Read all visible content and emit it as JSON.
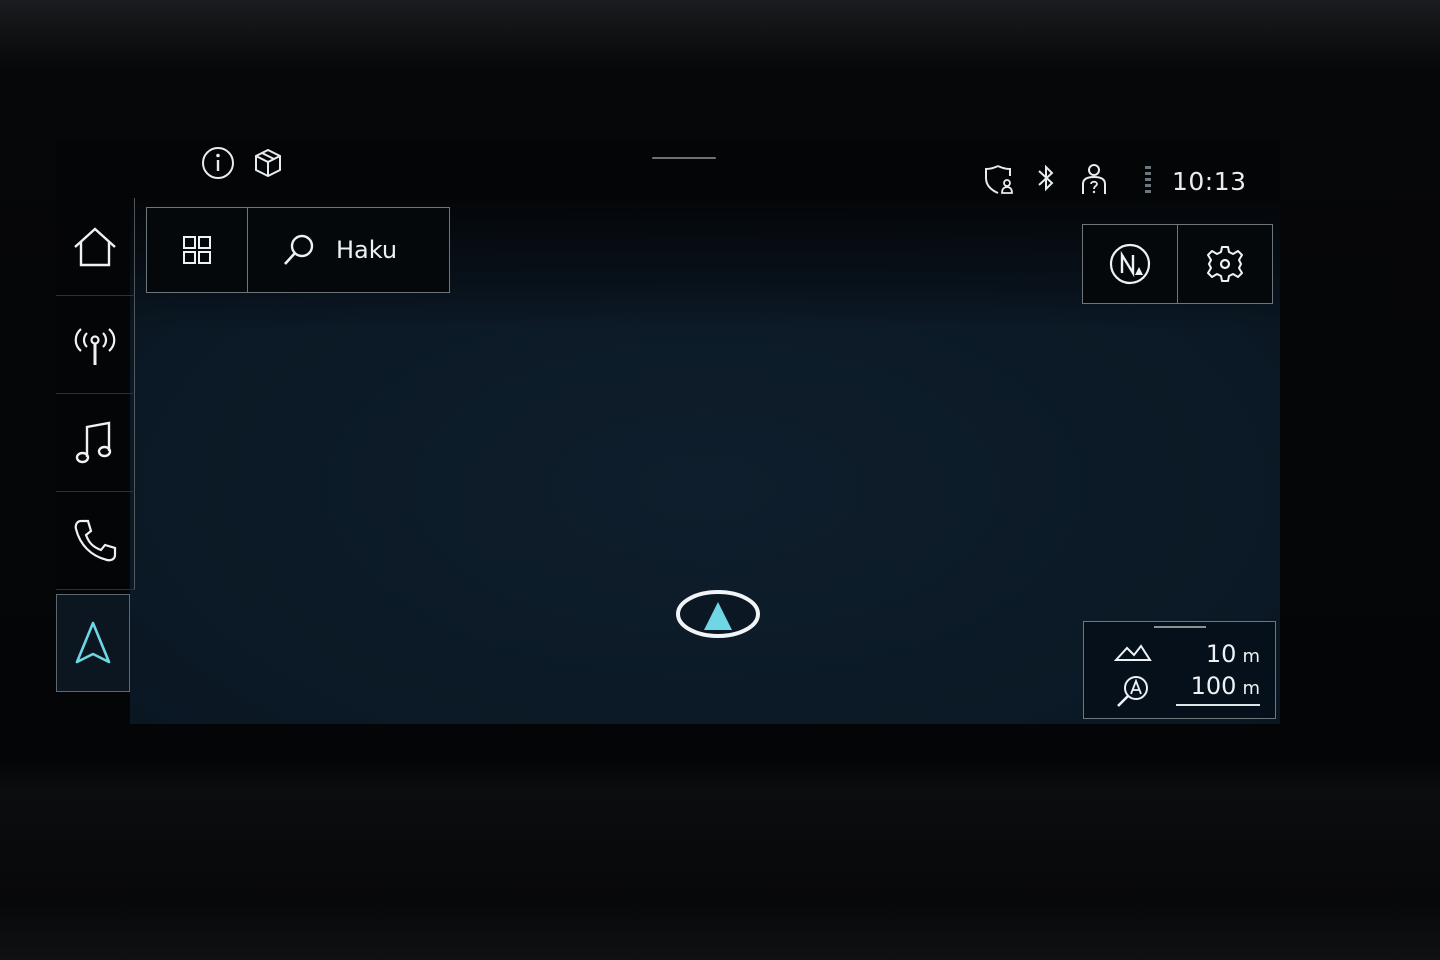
{
  "statusbar": {
    "info_icon": "info-icon",
    "package_icon": "package-icon",
    "privacy_icon": "privacy-shield-icon",
    "bluetooth_icon": "bluetooth-icon",
    "profile_icon": "user-profile-icon",
    "signal_icon": "signal-icon",
    "time": "10:13"
  },
  "sidebar": {
    "items": [
      {
        "icon": "home-icon"
      },
      {
        "icon": "radio-icon"
      },
      {
        "icon": "music-icon"
      },
      {
        "icon": "phone-icon"
      },
      {
        "icon": "navigation-icon",
        "active": true
      }
    ]
  },
  "toolbar": {
    "apps_icon": "grid-icon",
    "search_label": "Haku"
  },
  "map_controls": {
    "compass_icon": "north-compass-icon",
    "settings_icon": "gear-icon"
  },
  "scale": {
    "altitude_value": "10",
    "altitude_unit": "m",
    "zoom_value": "100",
    "zoom_unit": "m"
  },
  "colors": {
    "accent": "#6fd6e6",
    "map_background": "#0c1a27",
    "border": "#6d767b"
  }
}
